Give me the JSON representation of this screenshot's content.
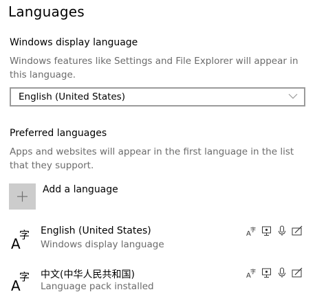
{
  "page": {
    "title": "Languages"
  },
  "display_language": {
    "heading": "Windows display language",
    "description": "Windows features like Settings and File Explorer will appear in this language.",
    "selected": "English (United States)"
  },
  "preferred": {
    "heading": "Preferred languages",
    "description": "Apps and websites will appear in the first language in the list that they support.",
    "add_label": "Add a language",
    "languages": [
      {
        "name": "English (United States)",
        "status": "Windows display language"
      },
      {
        "name": "中文(中华人民共和国)",
        "status": "Language pack installed"
      }
    ]
  },
  "icons": {
    "language": "language-icon",
    "add": "plus-icon",
    "chevron": "chevron-down-icon",
    "features": [
      "display-language-icon",
      "speech-recognition-icon",
      "microphone-icon",
      "handwriting-icon"
    ]
  },
  "colors": {
    "secondary_text": "#6b6b6b",
    "add_button_bg": "#cccccc",
    "dropdown_border": "#9a9a9a"
  }
}
